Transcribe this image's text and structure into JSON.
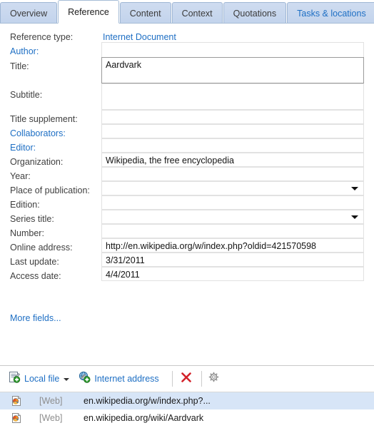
{
  "tabs": [
    {
      "label": "Overview",
      "selected": false,
      "link": false
    },
    {
      "label": "Reference",
      "selected": true,
      "link": false
    },
    {
      "label": "Content",
      "selected": false,
      "link": false
    },
    {
      "label": "Context",
      "selected": false,
      "link": false
    },
    {
      "label": "Quotations",
      "selected": false,
      "link": false
    },
    {
      "label": "Tasks & locations",
      "selected": false,
      "link": true
    }
  ],
  "form": {
    "reference_type_label": "Reference type:",
    "reference_type_value": "Internet Document",
    "author_label": "Author:",
    "author_value": "",
    "title_label": "Title:",
    "title_value": "Aardvark",
    "subtitle_label": "Subtitle:",
    "subtitle_value": "",
    "title_supplement_label": "Title supplement:",
    "title_supplement_value": "",
    "collaborators_label": "Collaborators:",
    "collaborators_value": "",
    "editor_label": "Editor:",
    "editor_value": "",
    "organization_label": "Organization:",
    "organization_value": "Wikipedia, the free encyclopedia",
    "year_label": "Year:",
    "year_value": "",
    "place_label": "Place of publication:",
    "place_value": "",
    "edition_label": "Edition:",
    "edition_value": "",
    "series_title_label": "Series title:",
    "series_title_value": "",
    "number_label": "Number:",
    "number_value": "",
    "online_address_label": "Online address:",
    "online_address_value": "http://en.wikipedia.org/w/index.php?oldid=421570598",
    "last_update_label": "Last update:",
    "last_update_value": "3/31/2011",
    "access_date_label": "Access date:",
    "access_date_value": "4/4/2011",
    "more_fields_label": "More fields..."
  },
  "toolbar": {
    "local_file_label": "Local file",
    "local_file_icon": "document-add-icon",
    "internet_address_label": "Internet address",
    "internet_address_icon": "globe-link-add-icon",
    "delete_icon": "red-x-delete-icon",
    "settings_icon": "gear-settings-icon"
  },
  "attachments": [
    {
      "type": "[Web]",
      "url": "en.wikipedia.org/w/index.php?...",
      "icon": "browser-document-icon",
      "selected": true
    },
    {
      "type": "[Web]",
      "url": "en.wikipedia.org/wiki/Aardvark",
      "icon": "browser-document-icon",
      "selected": false
    }
  ],
  "colors": {
    "link": "#1e6fc4",
    "tab_fill": "#c2d3ec",
    "tab_border": "#9eb6d4",
    "selection": "#d7e5f7",
    "label": "#3f3f3f",
    "delete_red": "#d3222a"
  }
}
